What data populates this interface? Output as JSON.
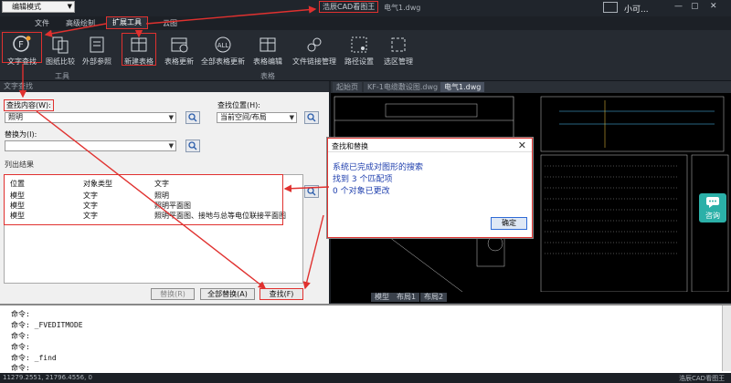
{
  "titlebar": {
    "mode": "编辑模式",
    "app_title": "浩辰CAD看图王",
    "file_title": "电气1.dwg",
    "user": "小可..."
  },
  "menu": {
    "tabs": [
      {
        "label": "文件"
      },
      {
        "label": "高级绘制"
      },
      {
        "label": "扩展工具"
      },
      {
        "label": "云图"
      }
    ]
  },
  "ribbon": {
    "buttons": [
      {
        "label": "文字查找"
      },
      {
        "label": "图纸比较"
      },
      {
        "label": "外部参照"
      },
      {
        "label": "新建表格"
      },
      {
        "label": "表格更新"
      },
      {
        "label": "全部表格更新"
      },
      {
        "label": "表格编辑"
      },
      {
        "label": "文件链接管理"
      },
      {
        "label": "路径设置"
      },
      {
        "label": "选区管理"
      }
    ],
    "groups": [
      "工具",
      "表格"
    ]
  },
  "panel": {
    "strip_label": "文字查找",
    "find_label": "查找内容(W):",
    "find_value": "照明",
    "location_label": "查找位置(H):",
    "location_value": "当前空间/布局",
    "replace_label": "替换为(I):",
    "replace_value": "",
    "results_label": "列出结果",
    "columns": [
      "位置",
      "对象类型",
      "文字"
    ],
    "rows": [
      {
        "position": "模型",
        "type": "文字",
        "text": "照明"
      },
      {
        "position": "模型",
        "type": "文字",
        "text": "照明平面图"
      },
      {
        "position": "模型",
        "type": "文字",
        "text": "照明平面图、接地与总等电位联接平面图"
      }
    ],
    "replace_button": "替换(R)",
    "replace_all_button": "全部替换(A)",
    "find_button": "查找(F)"
  },
  "drawing": {
    "tabs": [
      {
        "label": "起始页"
      },
      {
        "label": "KF-1电缆敷设图.dwg"
      },
      {
        "label": "电气1.dwg"
      }
    ],
    "layout_tabs": [
      {
        "label": "模型"
      },
      {
        "label": "布局1"
      },
      {
        "label": "布局2"
      }
    ]
  },
  "dialog": {
    "title": "查找和替换",
    "line1": "系统已完成对图形的搜索",
    "line2": "找到 3 个匹配项",
    "line3": "0 个对象已更改",
    "ok": "确定"
  },
  "consult": {
    "label": "咨询"
  },
  "command": {
    "lines": [
      "命令:",
      "命令: _FVEDITMODE",
      "命令:",
      "命令:",
      "命令: _find",
      "命令:"
    ]
  },
  "status": {
    "coords": "11279.2551, 21796.4556, 0",
    "right": "浩辰CAD看图王"
  },
  "colors": {
    "annotation_red": "#e0312f",
    "dialog_text": "#1f3fae",
    "canvas_bg": "#000000",
    "consult_bg": "#2bb0a8"
  }
}
